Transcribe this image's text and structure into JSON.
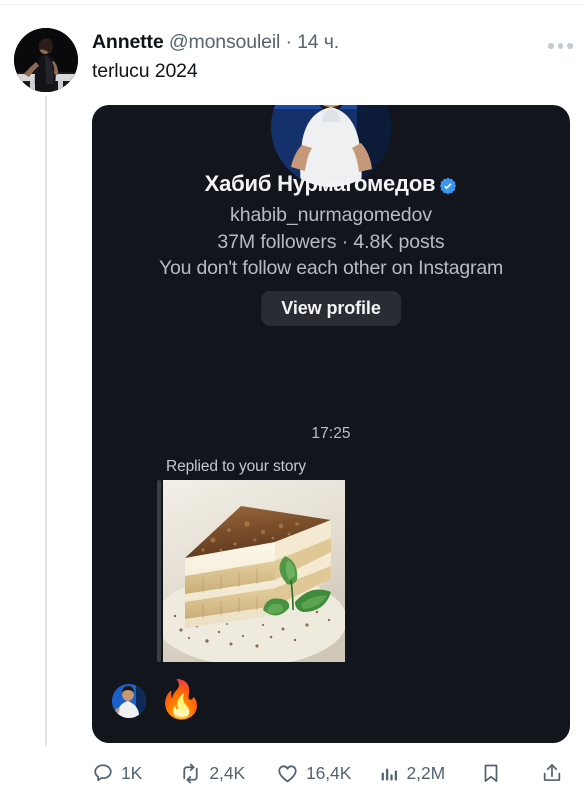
{
  "tweet": {
    "author_name": "Annette",
    "author_handle": "@monsouleil",
    "separator": " · ",
    "timestamp": "14 ч.",
    "body_text": "terlucu 2024",
    "more_icon": "more-horizontal-icon"
  },
  "instagram_card": {
    "profile_name": "Хабиб Нурмагомедов",
    "verified_badge": "verified-check-icon",
    "username": "khabib_nurmagomedov",
    "stats": "37M followers · 4.8K posts",
    "relationship": "You don't follow each other on Instagram",
    "view_profile_label": "View profile",
    "message_time": "17:25",
    "replied_label": "Replied to your story",
    "reaction_emoji": "🔥",
    "avatar_icon": "profile-photo",
    "reply_image": "tiramisu-dessert-photo",
    "colors": {
      "card_background": "#13151c",
      "verified_blue": "#3897f0",
      "button_background": "#2a2c33",
      "primary_text": "#f2f3f5",
      "secondary_text": "#b6bcc4"
    }
  },
  "actions": {
    "reply": {
      "icon": "comment-icon",
      "count": "1K"
    },
    "retweet": {
      "icon": "retweet-icon",
      "count": "2,4K"
    },
    "like": {
      "icon": "heart-icon",
      "count": "16,4K"
    },
    "views": {
      "icon": "analytics-icon",
      "count": "2,2M"
    },
    "bookmark": {
      "icon": "bookmark-icon",
      "count": ""
    },
    "share": {
      "icon": "share-icon",
      "count": ""
    }
  },
  "theme": {
    "page_background": "#ffffff",
    "text_primary": "#0f1419",
    "text_secondary": "#536471",
    "thread_line": "#dfe3e5"
  }
}
